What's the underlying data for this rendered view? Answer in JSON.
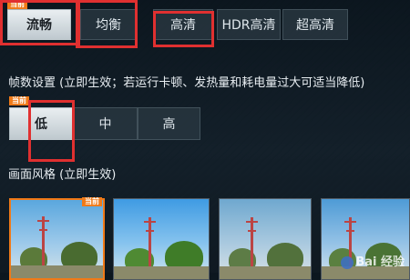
{
  "quality_options": [
    {
      "label": "流畅",
      "selected": true
    },
    {
      "label": "均衡",
      "selected": false
    },
    {
      "label": "高清",
      "selected": false
    },
    {
      "label": "HDR高清",
      "selected": false
    },
    {
      "label": "超高清",
      "selected": false
    }
  ],
  "current_tag": "当前",
  "fps": {
    "label": "帧数设置 (立即生效；若运行卡顿、发热量和耗电量过大可适当降低)",
    "options": [
      {
        "label": "低",
        "selected": true
      },
      {
        "label": "中",
        "selected": false
      },
      {
        "label": "高",
        "selected": false
      }
    ]
  },
  "style": {
    "label": "画面风格 (立即生效)",
    "thumbnails": [
      {
        "selected": true
      },
      {
        "selected": false
      },
      {
        "selected": false
      },
      {
        "selected": false
      }
    ]
  },
  "watermark": "Bai 经验",
  "colors": {
    "accent": "#f07a18",
    "highlight": "#e03030"
  }
}
